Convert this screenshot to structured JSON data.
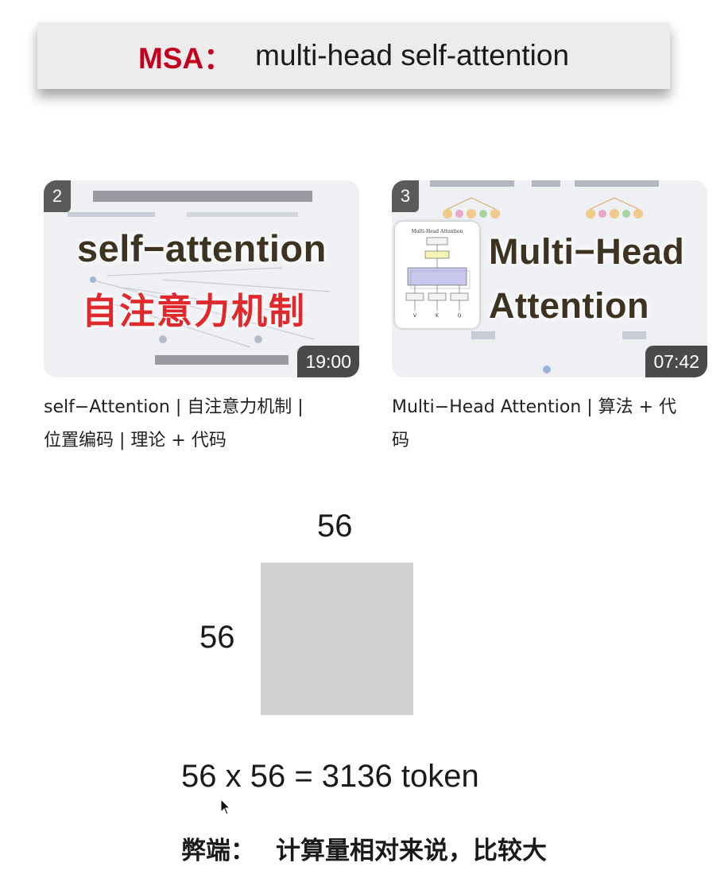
{
  "banner": {
    "accent": "MSA：",
    "title": "multi-head self-attention"
  },
  "videos": [
    {
      "index": "2",
      "thumb_line1": "self−attention",
      "thumb_line2": "自注意力机制",
      "duration": "19:00",
      "caption_line1": "self−Attention | 自注意力机制 |",
      "caption_line2": "位置编码 | 理论 + 代码"
    },
    {
      "index": "3",
      "thumb_line1": "Multi−Head",
      "thumb_line2": "Attention",
      "inset_title": "Multi-Head Attention",
      "duration": "07:42",
      "caption_line1": "Multi−Head Attention | 算法 + 代",
      "caption_line2": "码"
    }
  ],
  "grid": {
    "top_label": "56",
    "left_label": "56"
  },
  "formula": "56 x 56 = 3136 token",
  "drawback": {
    "label": "弊端：",
    "text": "计算量相对来说，比较大"
  },
  "colors": {
    "accent": "#c3001e",
    "square": "#d1d1d1",
    "banner_bg": "#ececec"
  }
}
